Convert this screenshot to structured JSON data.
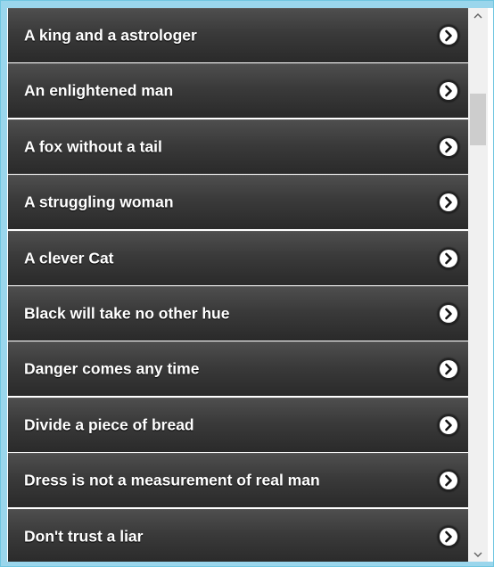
{
  "list": {
    "items": [
      {
        "label": "A king and a astrologer"
      },
      {
        "label": "An enlightened man"
      },
      {
        "label": "A fox without a tail"
      },
      {
        "label": "A struggling woman"
      },
      {
        "label": "A clever Cat"
      },
      {
        "label": "Black will take no other hue"
      },
      {
        "label": "Danger comes any time"
      },
      {
        "label": "Divide a piece of bread"
      },
      {
        "label": "Dress is not a measurement of real man"
      },
      {
        "label": "Don't trust a liar"
      }
    ],
    "item_icon": "chevron-right-circle-icon"
  },
  "scrollbar": {
    "position_fraction": 0.15
  }
}
